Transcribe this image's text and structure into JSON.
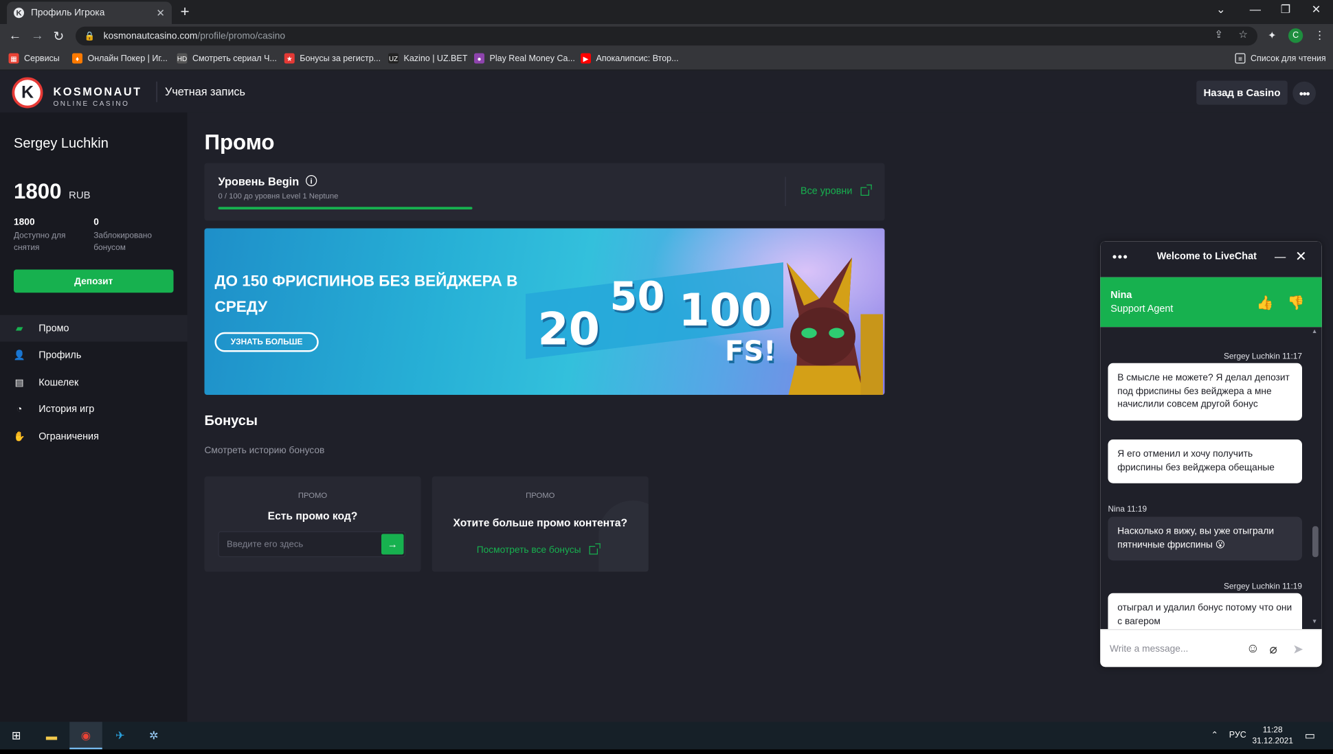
{
  "browser": {
    "tab_title": "Профиль Игрока",
    "url_host": "kosmonautcasino.com",
    "url_path": "/profile/promo/casino",
    "profile_letter": "C",
    "bookmarks": [
      {
        "label": "Сервисы",
        "icon": "apps-grid-icon",
        "color": "#ea4335"
      },
      {
        "label": "Онлайн Покер | Иг...",
        "icon": "poker-icon",
        "color": "#ff7a00"
      },
      {
        "label": "Смотреть сериал Ч...",
        "icon": "hd-icon",
        "color": "#555555"
      },
      {
        "label": "Бонусы за регистр...",
        "icon": "star-icon",
        "color": "#e53935"
      },
      {
        "label": "Kazino | UZ.BET",
        "icon": "uz-icon",
        "color": "#222222"
      },
      {
        "label": "Play Real Money Ca...",
        "icon": "casino-icon",
        "color": "#8e44ad"
      },
      {
        "label": "Апокалипсис: Втор...",
        "icon": "youtube-icon",
        "color": "#ff0000"
      }
    ],
    "reading_list": "Список для чтения"
  },
  "header": {
    "logo_name": "KOSMONAUT",
    "logo_sub": "ONLINE CASINO",
    "section": "Учетная запись",
    "back_button": "Назад в Casino"
  },
  "sidebar": {
    "user_name": "Sergey Luchkin",
    "balance": "1800",
    "currency": "RUB",
    "available_value": "1800",
    "available_label": "Доступно для снятия",
    "locked_value": "0",
    "locked_label": "Заблокировано бонусом",
    "deposit_button": "Депозит",
    "nav": [
      {
        "label": "Промо",
        "icon": "gift-icon",
        "active": true
      },
      {
        "label": "Профиль",
        "icon": "user-icon",
        "active": false
      },
      {
        "label": "Кошелек",
        "icon": "wallet-icon",
        "active": false
      },
      {
        "label": "История игр",
        "icon": "clock-icon",
        "active": false
      },
      {
        "label": "Ограничения",
        "icon": "hand-icon",
        "active": false
      }
    ]
  },
  "main": {
    "title": "Промо",
    "level": {
      "name": "Уровень Begin",
      "progress_text": "0 / 100 до уровня Level 1 Neptune",
      "all_levels_link": "Все уровни"
    },
    "banner": {
      "headline": "ДО 150 ФРИСПИНОВ БЕЗ ВЕЙДЖЕРА В СРЕДУ",
      "button": "УЗНАТЬ БОЛЬШЕ",
      "numbers": [
        "20",
        "50",
        "100"
      ],
      "fs": "FS!"
    },
    "bonuses": {
      "title": "Бонусы",
      "history_link": "Смотреть историю бонусов",
      "promo_code_card": {
        "label": "ПРОМО",
        "title": "Есть промо код?",
        "placeholder": "Введите его здесь"
      },
      "more_content_card": {
        "label": "ПРОМО",
        "title": "Хотите больше промо контента?",
        "link": "Посмотреть все бонусы"
      }
    }
  },
  "livechat": {
    "title": "Welcome to LiveChat",
    "agent_name": "Nina",
    "agent_role": "Support Agent",
    "messages": [
      {
        "meta": "Sergey Luchkin 11:17",
        "from": "user",
        "text": "В смысле не можете? Я делал депозит под фриспины без вейджера а мне начислили совсем другой бонус"
      },
      {
        "meta": "",
        "from": "user",
        "text": "Я его отменил и хочу получить фриспины без вейджера обещаные"
      },
      {
        "meta": "Nina 11:19",
        "from": "agent",
        "text": "Насколько я вижу, вы уже отыграли пятничные фриспины 😮"
      },
      {
        "meta": "Sergey Luchkin 11:19",
        "from": "user",
        "text": "отыграл и удалил бонус потому что они с вагером"
      }
    ],
    "input_placeholder": "Write a message..."
  },
  "taskbar": {
    "language": "РУС",
    "time": "11:28",
    "date": "31.12.2021"
  }
}
